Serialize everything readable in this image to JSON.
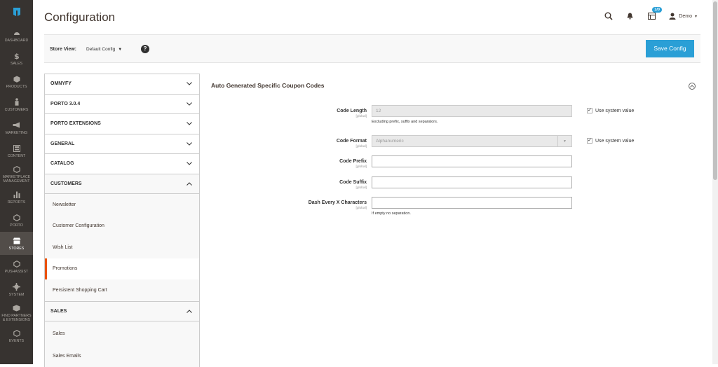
{
  "nav": {
    "items": [
      {
        "label": "DASHBOARD",
        "icon": "dashboard-icon"
      },
      {
        "label": "SALES",
        "icon": "dollar-icon"
      },
      {
        "label": "PRODUCTS",
        "icon": "cube-icon"
      },
      {
        "label": "CUSTOMERS",
        "icon": "person-icon"
      },
      {
        "label": "MARKETING",
        "icon": "megaphone-icon"
      },
      {
        "label": "CONTENT",
        "icon": "layout-icon"
      },
      {
        "label": "MARKETPLACE MANAGEMENT",
        "icon": "hexagon-icon"
      },
      {
        "label": "REPORTS",
        "icon": "bar-chart-icon"
      },
      {
        "label": "PORTO",
        "icon": "hexagon-icon"
      },
      {
        "label": "STORES",
        "icon": "store-icon"
      },
      {
        "label": "PUSHASSIST",
        "icon": "hexagon-icon"
      },
      {
        "label": "SYSTEM",
        "icon": "gear-icon"
      },
      {
        "label": "FIND PARTNERS & EXTENSIONS",
        "icon": "box-icon"
      },
      {
        "label": "EVENTS",
        "icon": "hexagon-icon"
      }
    ]
  },
  "header": {
    "title": "Configuration",
    "notifications_count": "1/0",
    "user": "Demo"
  },
  "store_bar": {
    "label": "Store View:",
    "value": "Default Config",
    "save_label": "Save Config"
  },
  "tabs": {
    "omnyfy": "OMNYFY",
    "porto": "PORTO 3.0.4",
    "porto_ext": "PORTO EXTENSIONS",
    "general": "GENERAL",
    "catalog": "CATALOG",
    "customers": "CUSTOMERS",
    "customers_items": [
      "Newsletter",
      "Customer Configuration",
      "Wish List",
      "Promotions",
      "Persistent Shopping Cart"
    ],
    "sales": "SALES",
    "sales_items": [
      "Sales",
      "Sales Emails"
    ]
  },
  "section": {
    "title": "Auto Generated Specific Coupon Codes",
    "fields": {
      "code_length": {
        "label": "Code Length",
        "scope": "[global]",
        "value": "12",
        "note": "Excluding prefix, suffix and separators.",
        "system": "Use system value"
      },
      "code_format": {
        "label": "Code Format",
        "scope": "[global]",
        "value": "Alphanumeric",
        "system": "Use system value"
      },
      "code_prefix": {
        "label": "Code Prefix",
        "scope": "[global]",
        "value": ""
      },
      "code_suffix": {
        "label": "Code Suffix",
        "scope": "[global]",
        "value": ""
      },
      "dash_every": {
        "label": "Dash Every X Characters",
        "scope": "[global]",
        "value": "",
        "note": "If empty no separation."
      }
    }
  },
  "colors": {
    "nav_bg": "#373330",
    "accent": "#2a9fd6",
    "active_marker": "#eb5202"
  }
}
